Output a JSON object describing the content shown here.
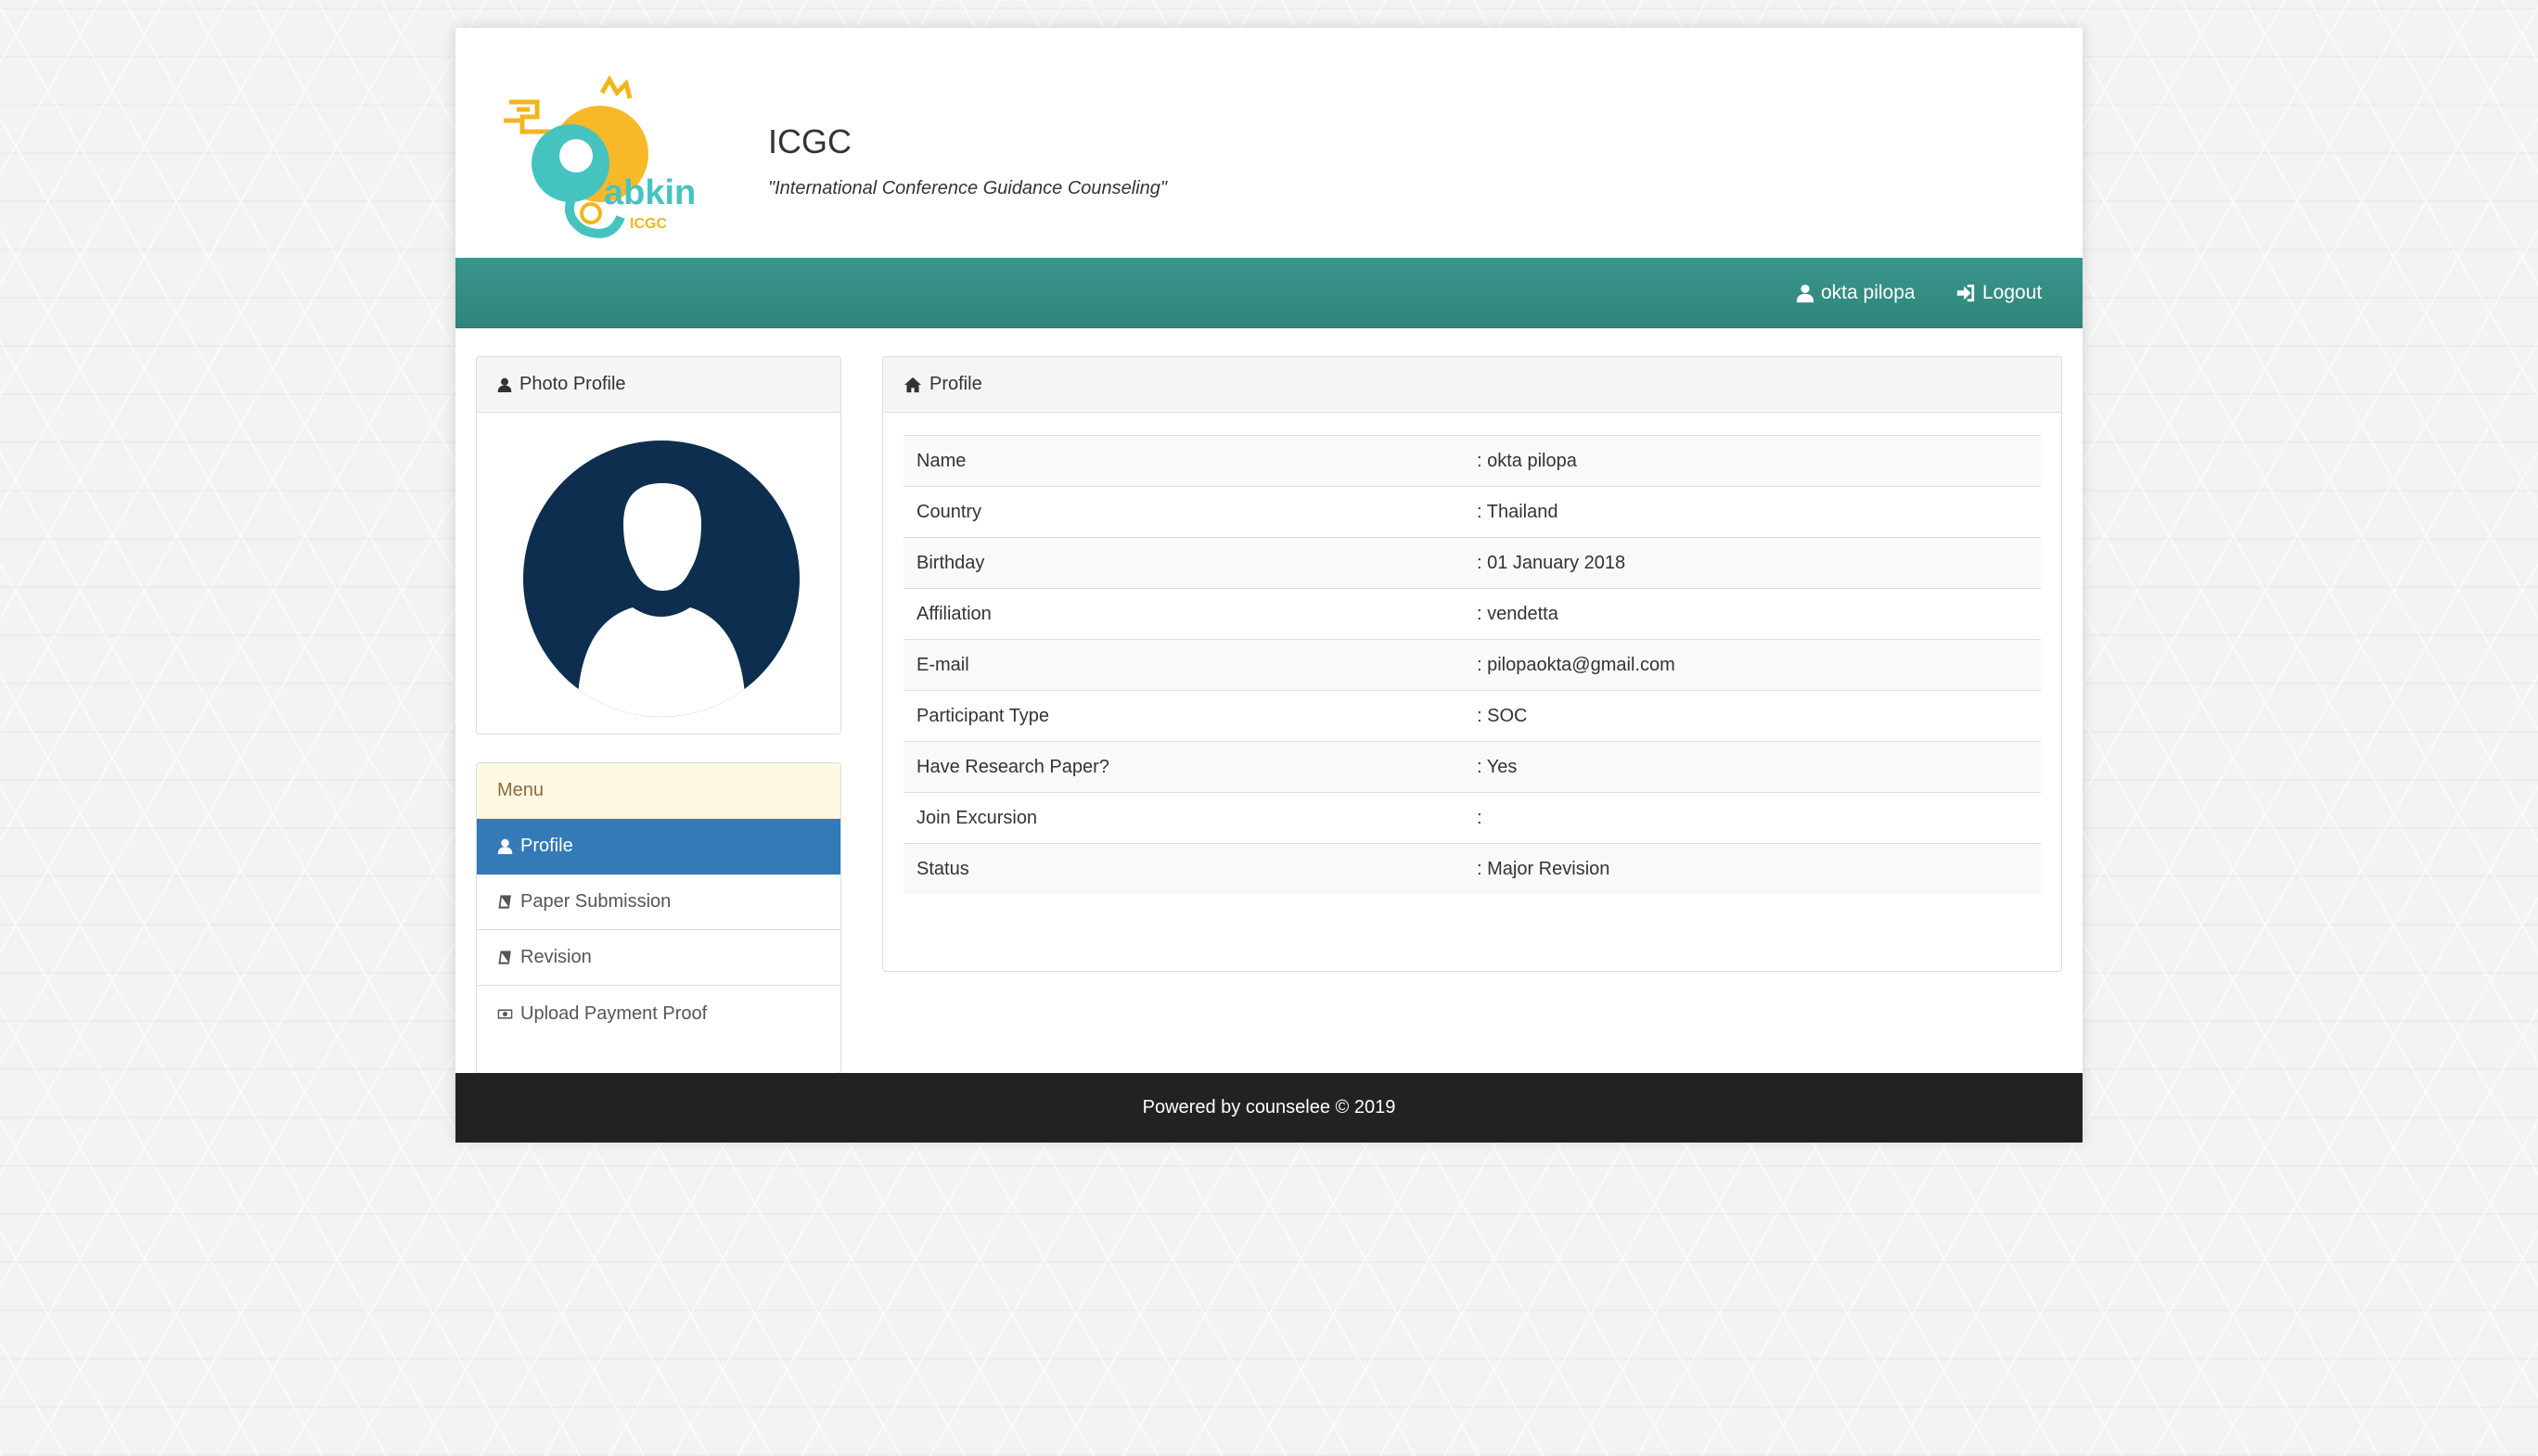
{
  "header": {
    "logo_alt": "Gabkin ICGC",
    "title": "ICGC",
    "subtitle": "\"International Conference Guidance Counseling\""
  },
  "navbar": {
    "user_label": "okta pilopa",
    "logout_label": "Logout",
    "color": "#36918a"
  },
  "photo_panel": {
    "title": "Photo Profile"
  },
  "profile_panel": {
    "title": "Profile",
    "rows": [
      {
        "label": "Name",
        "value": ": okta pilopa"
      },
      {
        "label": "Country",
        "value": ": Thailand"
      },
      {
        "label": "Birthday",
        "value": ": 01 January 2018"
      },
      {
        "label": "Affiliation",
        "value": ": vendetta"
      },
      {
        "label": "E-mail",
        "value": ": pilopaokta@gmail.com"
      },
      {
        "label": "Participant Type",
        "value": ": SOC"
      },
      {
        "label": "Have Research Paper?",
        "value": ": Yes"
      },
      {
        "label": "Join Excursion",
        "value": ":"
      },
      {
        "label": "Status",
        "value": ": Major Revision"
      }
    ]
  },
  "menu": {
    "title": "Menu",
    "items": [
      {
        "label": "Profile",
        "icon": "user-icon",
        "active": true
      },
      {
        "label": "Paper Submission",
        "icon": "book-icon",
        "active": false
      },
      {
        "label": "Revision",
        "icon": "book-icon",
        "active": false
      },
      {
        "label": "Upload Payment Proof",
        "icon": "money-icon",
        "active": false
      }
    ]
  },
  "footer": {
    "text": "Powered by counselee © 2019"
  }
}
